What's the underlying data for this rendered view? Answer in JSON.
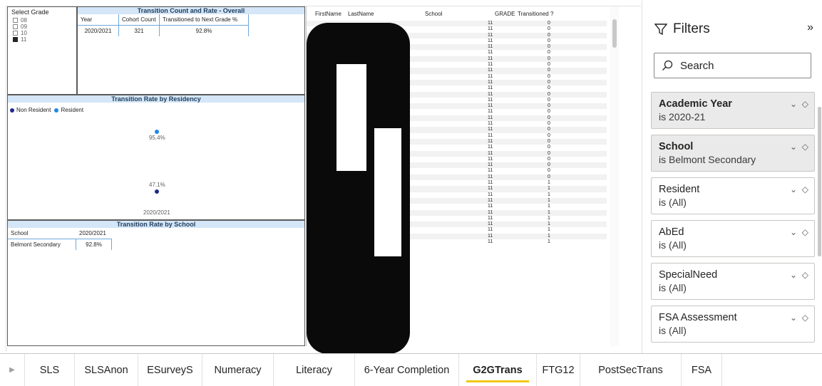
{
  "slicer": {
    "title": "Select Grade",
    "options": [
      {
        "label": "08",
        "checked": false
      },
      {
        "label": "09",
        "checked": false
      },
      {
        "label": "10",
        "checked": false
      },
      {
        "label": "11",
        "checked": true
      }
    ]
  },
  "overall": {
    "title": "Transition Count and Rate - Overall",
    "headers": [
      "Year",
      "Cohort Count",
      "Transitioned to Next Grade %"
    ],
    "row": [
      "2020/2021",
      "321",
      "92.8%"
    ]
  },
  "residency": {
    "title": "Transition Rate by Residency",
    "legend": [
      {
        "label": "Non Resident",
        "color": "#1f2a8c"
      },
      {
        "label": "Resident",
        "color": "#1e88e5"
      }
    ],
    "chart_data": {
      "type": "scatter",
      "categories": [
        "2020/2021"
      ],
      "series": [
        {
          "name": "Resident",
          "values": [
            95.4
          ]
        },
        {
          "name": "Non Resident",
          "values": [
            47.1
          ]
        }
      ],
      "labels": [
        "95.4%",
        "47.1%"
      ]
    },
    "xlabel": "2020/2021"
  },
  "school": {
    "title": "Transition Rate by School",
    "headers": [
      "School",
      "2020/2021"
    ],
    "row": [
      "Belmont Secondary",
      "92.8%"
    ]
  },
  "students": {
    "headers": [
      "FirstName",
      "LastName",
      "School",
      "GRADE",
      "Transitioned ?"
    ],
    "grade": "11",
    "transitioned": [
      "0",
      "0",
      "0",
      "0",
      "0",
      "0",
      "0",
      "0",
      "0",
      "0",
      "0",
      "0",
      "0",
      "0",
      "0",
      "0",
      "0",
      "0",
      "0",
      "0",
      "0",
      "0",
      "0",
      "0",
      "0",
      "0",
      "0",
      "1",
      "1",
      "1",
      "1",
      "1",
      "1",
      "1",
      "1",
      "1",
      "1",
      "1"
    ]
  },
  "filters": {
    "title": "Filters",
    "search_placeholder": "Search",
    "cards": [
      {
        "name": "Academic Year",
        "value": "is 2020-21",
        "active": true
      },
      {
        "name": "School",
        "value": "is Belmont Secondary",
        "active": true
      },
      {
        "name": "Resident",
        "value": "is (All)",
        "active": false
      },
      {
        "name": "AbEd",
        "value": "is (All)",
        "active": false
      },
      {
        "name": "SpecialNeed",
        "value": "is (All)",
        "active": false
      },
      {
        "name": "FSA Assessment",
        "value": "is (All)",
        "active": false
      }
    ]
  },
  "tabs": [
    {
      "label": "SLS",
      "width": 70
    },
    {
      "label": "SLSAnon",
      "width": 89
    },
    {
      "label": "ESurveyS",
      "width": 90
    },
    {
      "label": "Numeracy",
      "width": 100
    },
    {
      "label": "Literacy",
      "width": 114
    },
    {
      "label": "6-Year Completion",
      "width": 146
    },
    {
      "label": "G2GTrans",
      "width": 109,
      "active": true
    },
    {
      "label": "FTG12",
      "width": 61
    },
    {
      "label": "PostSecTrans",
      "width": 142
    },
    {
      "label": "FSA",
      "width": 57
    }
  ]
}
